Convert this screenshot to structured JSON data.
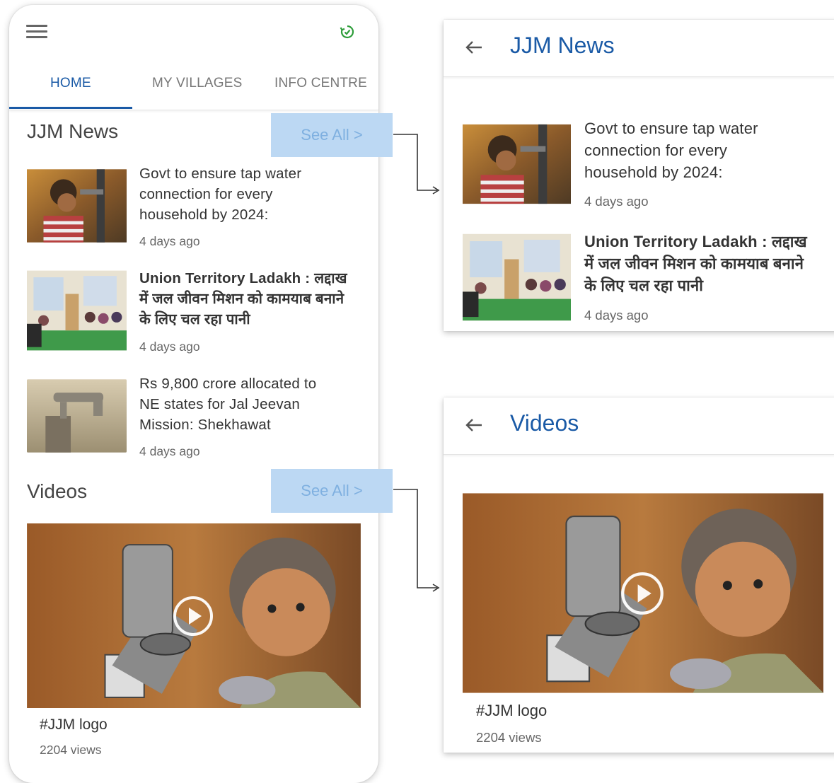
{
  "tabs": [
    "HOME",
    "MY VILLAGES",
    "INFO CENTRE"
  ],
  "active_tab": "HOME",
  "news": {
    "title": "JJM News",
    "see_all": "See All >",
    "items": [
      {
        "title": "Govt to ensure tap water connection for every household by 2024:",
        "time": "4 days ago"
      },
      {
        "title": "Union Territory Ladakh : लद्दाख में जल जीवन मिशन को कामयाब बनाने के लिए चल रहा पानी",
        "time": "4 days ago"
      },
      {
        "title": "Rs 9,800 crore allocated to NE states for Jal Jeevan Mission: Shekhawat",
        "time": "4 days ago"
      }
    ]
  },
  "videos": {
    "title": "Videos",
    "see_all": "See All >",
    "items": [
      {
        "title": "#JJM logo",
        "views": "2204 views"
      }
    ]
  },
  "news_page": {
    "title": "JJM News",
    "items": [
      {
        "title": "Govt to ensure tap water connection for every household by 2024:",
        "time": "4 days ago"
      },
      {
        "title": "Union Territory Ladakh : लद्दाख में जल जीवन मिशन को कामयाब बनाने के लिए चल रहा पानी",
        "time": "4 days ago"
      }
    ]
  },
  "videos_page": {
    "title": "Videos",
    "items": [
      {
        "title": "#JJM logo",
        "views": "2204 views"
      }
    ]
  },
  "colors": {
    "accent": "#1a5aa6",
    "highlight": "#bcd8f3",
    "sync_green": "#2e9d3a"
  },
  "icons": [
    "menu-icon",
    "sync-icon",
    "back-arrow-icon",
    "play-icon"
  ]
}
